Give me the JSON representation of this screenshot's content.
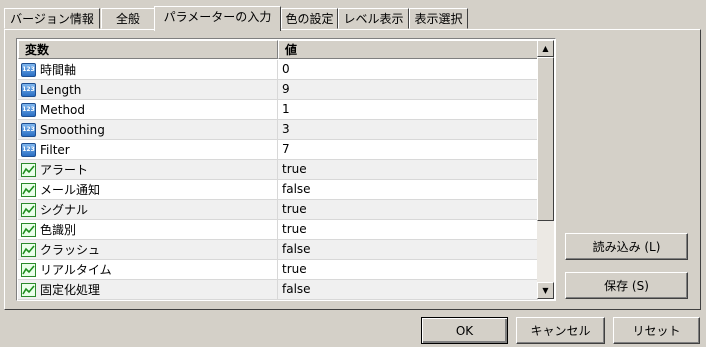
{
  "tabs": [
    {
      "label": "バージョン情報"
    },
    {
      "label": "全般"
    },
    {
      "label": "パラメーターの入力",
      "active": true
    },
    {
      "label": "色の設定"
    },
    {
      "label": "レベル表示"
    },
    {
      "label": "表示選択"
    }
  ],
  "table": {
    "columns": [
      "変数",
      "値"
    ],
    "rows": [
      {
        "icon": "numeric-param-icon",
        "name": "時間軸",
        "value": "0"
      },
      {
        "icon": "numeric-param-icon",
        "name": "Length",
        "value": "9"
      },
      {
        "icon": "numeric-param-icon",
        "name": "Method",
        "value": "1"
      },
      {
        "icon": "numeric-param-icon",
        "name": "Smoothing",
        "value": "3"
      },
      {
        "icon": "numeric-param-icon",
        "name": "Filter",
        "value": "7"
      },
      {
        "icon": "boolean-param-icon",
        "name": "アラート",
        "value": "true"
      },
      {
        "icon": "boolean-param-icon",
        "name": "メール通知",
        "value": "false"
      },
      {
        "icon": "boolean-param-icon",
        "name": "シグナル",
        "value": "true"
      },
      {
        "icon": "boolean-param-icon",
        "name": "色識別",
        "value": "true"
      },
      {
        "icon": "boolean-param-icon",
        "name": "クラッシュ",
        "value": "false"
      },
      {
        "icon": "boolean-param-icon",
        "name": "リアルタイム",
        "value": "true"
      },
      {
        "icon": "boolean-param-icon",
        "name": "固定化処理",
        "value": "false"
      }
    ]
  },
  "icons": {
    "numeric_glyph": "123"
  },
  "buttons": {
    "load": "読み込み (L)",
    "save": "保存 (S)",
    "ok": "OK",
    "cancel": "キャンセル",
    "reset": "リセット"
  }
}
